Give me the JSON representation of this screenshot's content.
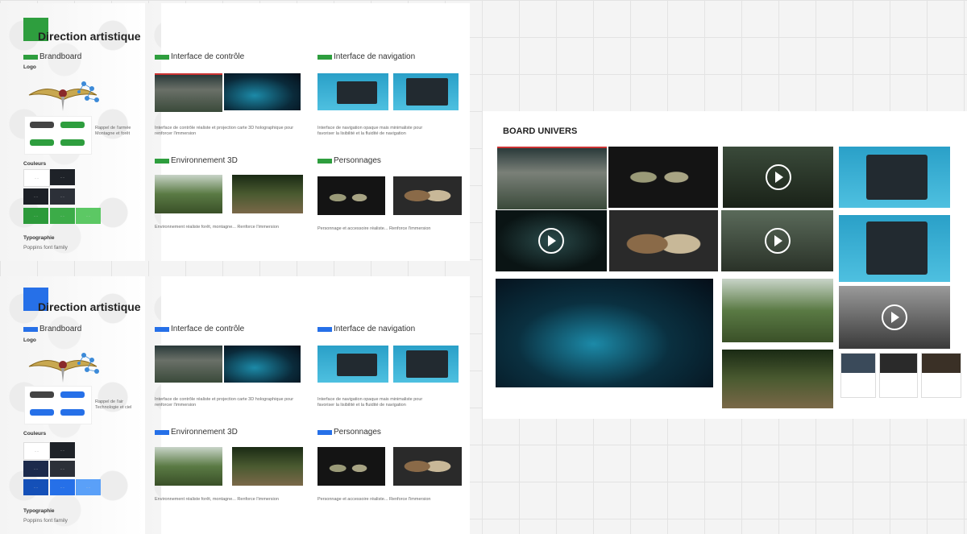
{
  "board1": {
    "title": "Direction artistique",
    "accent": "#2e9e3e",
    "sections": {
      "brandboard": "Brandboard",
      "controle": "Interface de contrôle",
      "navigation": "Interface de navigation",
      "env3d": "Environnement 3D",
      "personnages": "Personnages"
    },
    "logo_label": "Logo",
    "logo_caption": "Rappel de l'armée\nMontagne et forêt",
    "couleurs_label": "Couleurs",
    "typo_label": "Typographie",
    "typo_value": "Poppins font family",
    "desc_controle": "Interface de contrôle réaliste et projection carte 3D holographique pour renforcer l'immersion",
    "desc_navigation": "Interface de navigation opaque mais minimaliste pour favoriser la lisibilité et la fluidité de navigation",
    "desc_env": "Environnement réaliste forêt, montagne... Renforce l'immersion",
    "desc_perso": "Personnage et accessoire réaliste... Renforce l'immersion",
    "swatches": [
      "#ffffff",
      "#1e2228",
      "#1c2026",
      "#2c3038",
      "#2c9a3a",
      "#3cac48",
      "#5cc864"
    ]
  },
  "board2": {
    "title": "Direction artistique",
    "accent": "#2670e8",
    "sections": {
      "brandboard": "Brandboard",
      "controle": "Interface de contrôle",
      "navigation": "Interface de navigation",
      "env3d": "Environnement 3D",
      "personnages": "Personnages"
    },
    "logo_label": "Logo",
    "logo_caption": "Rappel de l'air\nTechnologie et ciel",
    "couleurs_label": "Couleurs",
    "typo_label": "Typographie",
    "typo_value": "Poppins font family",
    "desc_controle": "Interface de contrôle réaliste et projection carte 3D holographique pour renforcer l'immersion",
    "desc_navigation": "Interface de navigation opaque mais minimaliste pour favoriser la lisibilité et la fluidité de navigation",
    "desc_env": "Environnement réaliste forêt, montagne... Renforce l'immersion",
    "desc_perso": "Personnage et accessoire réaliste... Renforce l'immersion",
    "swatches": [
      "#ffffff",
      "#1e2228",
      "#1c2a4c",
      "#2c3038",
      "#1450b8",
      "#2670e8",
      "#5aa0f8"
    ]
  },
  "univers": {
    "title": "BOARD UNIVERS"
  }
}
